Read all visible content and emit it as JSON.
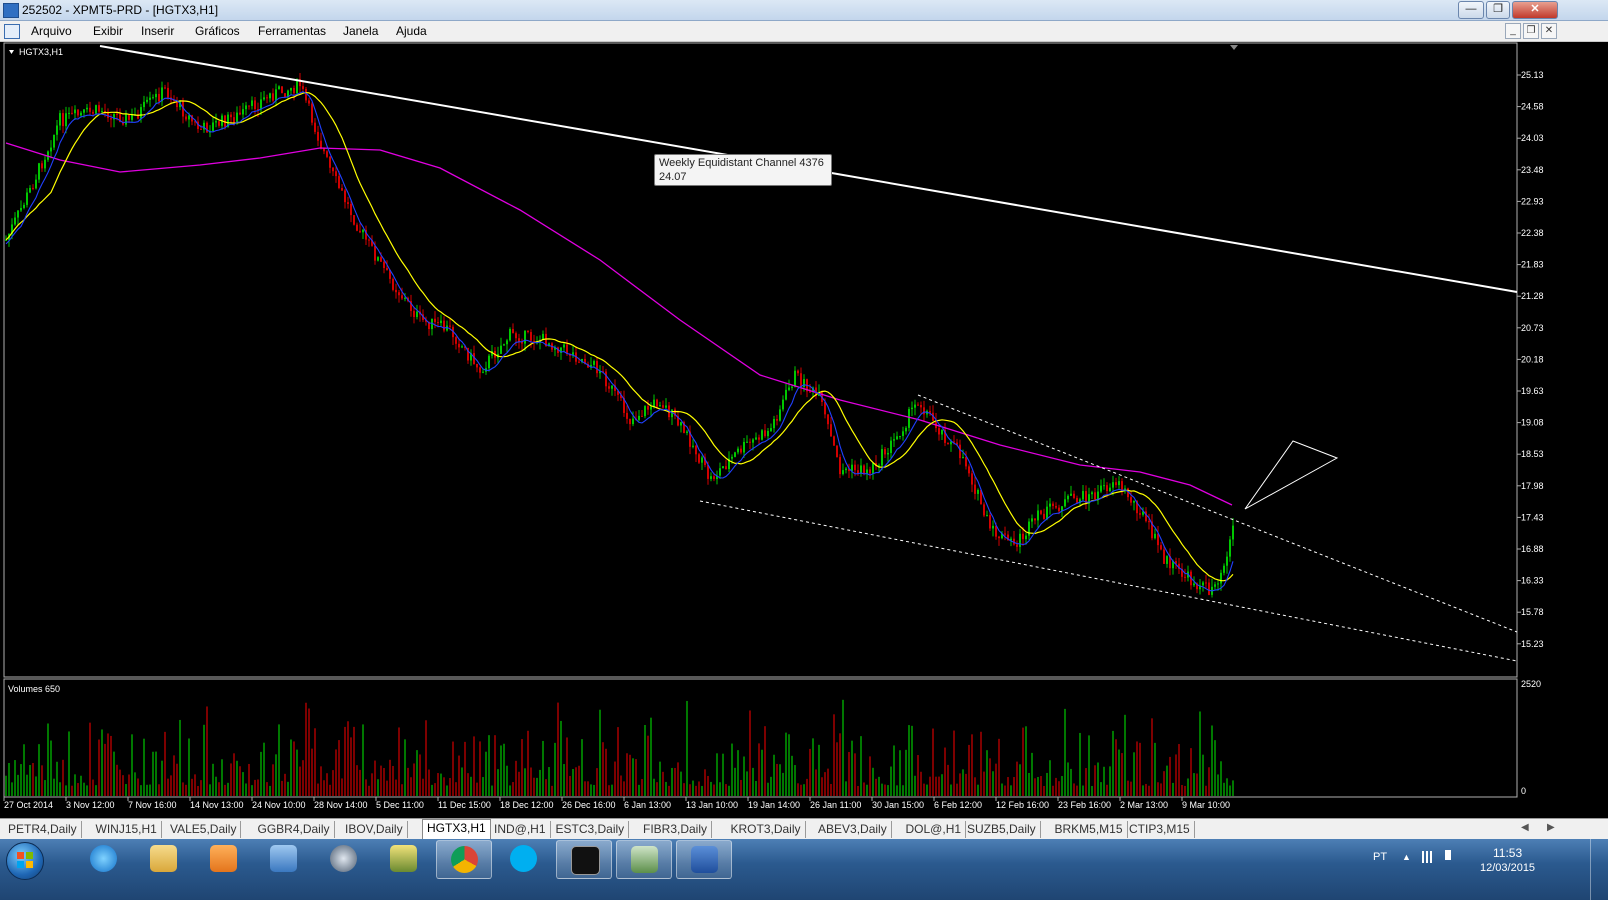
{
  "window": {
    "title": "252502 - XPMT5-PRD - [HGTX3,H1]"
  },
  "menu": [
    "Arquivo",
    "Exibir",
    "Inserir",
    "Gráficos",
    "Ferramentas",
    "Janela",
    "Ajuda"
  ],
  "chart": {
    "symbol_label": "HGTX3,H1",
    "volume_label": "Volumes 650",
    "price_ticks": [
      "25.13",
      "24.58",
      "24.03",
      "23.48",
      "22.93",
      "22.38",
      "21.83",
      "21.28",
      "20.73",
      "20.18",
      "19.63",
      "19.08",
      "18.53",
      "17.98",
      "17.43",
      "16.88",
      "16.33",
      "15.78",
      "15.23"
    ],
    "volume_ticks": [
      "2520",
      "0"
    ],
    "time_ticks": [
      "27 Oct 2014",
      "3 Nov 12:00",
      "7 Nov 16:00",
      "14 Nov 13:00",
      "24 Nov 10:00",
      "28 Nov 14:00",
      "5 Dec 11:00",
      "11 Dec 15:00",
      "18 Dec 12:00",
      "26 Dec 16:00",
      "6 Jan 13:00",
      "13 Jan 10:00",
      "19 Jan 14:00",
      "26 Jan 11:00",
      "30 Jan 15:00",
      "6 Feb 12:00",
      "12 Feb 16:00",
      "23 Feb 16:00",
      "2 Mar 13:00",
      "9 Mar 10:00"
    ],
    "tooltip": {
      "line1": "Weekly Equidistant Channel 4376",
      "line2": "24.07"
    },
    "colors": {
      "up_bar": "#00c800",
      "down_bar": "#d20000",
      "ma_fast": "#2040ff",
      "ma_mid": "#ffff00",
      "ma_slow": "#e000e0",
      "trendline": "#ffffff"
    }
  },
  "tabs": [
    {
      "label": "PETR4,Daily"
    },
    {
      "label": "WINJ15,H1"
    },
    {
      "label": "VALE5,Daily"
    },
    {
      "label": "GGBR4,Daily"
    },
    {
      "label": "IBOV,Daily"
    },
    {
      "label": "HGTX3,H1",
      "active": true
    },
    {
      "label": "IND@,H1"
    },
    {
      "label": "ESTC3,Daily"
    },
    {
      "label": "FIBR3,Daily"
    },
    {
      "label": "KROT3,Daily"
    },
    {
      "label": "ABEV3,Daily"
    },
    {
      "label": "DOL@,H1"
    },
    {
      "label": "SUZB5,Daily"
    },
    {
      "label": "BRKM5,M15"
    },
    {
      "label": "CTIP3,M15"
    }
  ],
  "taskbar": {
    "apps": [
      "internet-explorer-icon",
      "file-explorer-icon",
      "media-player-icon",
      "network-icon",
      "hp-icon",
      "ftp-icon",
      "chrome-icon",
      "skype-icon",
      "xp-icon",
      "metatrader-icon",
      "word-icon"
    ],
    "tray": {
      "language": "PT",
      "time": "11:53",
      "date": "12/03/2015"
    }
  }
}
